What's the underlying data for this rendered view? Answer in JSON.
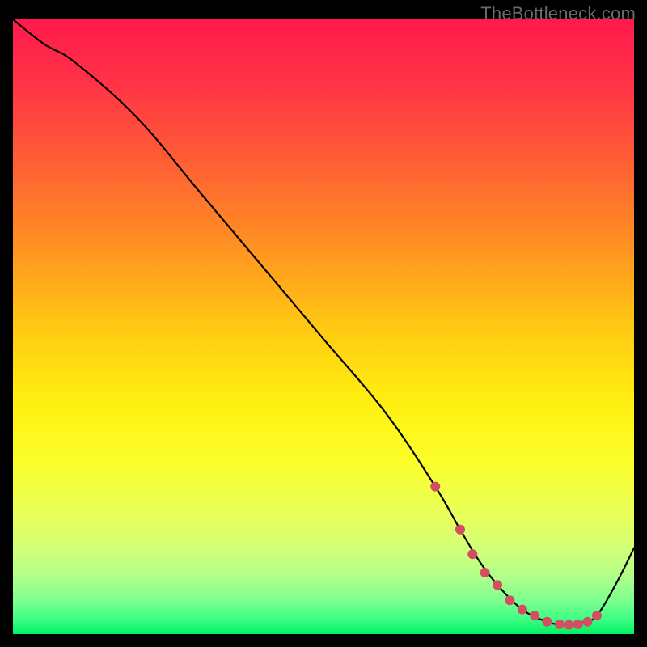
{
  "watermark": "TheBottleneck.com",
  "gradient": {
    "stops": [
      {
        "offset": 0.0,
        "color": "#ff1a4b"
      },
      {
        "offset": 0.1,
        "color": "#ff3246"
      },
      {
        "offset": 0.22,
        "color": "#ff5a36"
      },
      {
        "offset": 0.35,
        "color": "#ff8a24"
      },
      {
        "offset": 0.5,
        "color": "#ffc912"
      },
      {
        "offset": 0.62,
        "color": "#ffef10"
      },
      {
        "offset": 0.72,
        "color": "#fbff2a"
      },
      {
        "offset": 0.8,
        "color": "#eaff58"
      },
      {
        "offset": 0.86,
        "color": "#d3ff76"
      },
      {
        "offset": 0.905,
        "color": "#b2ff8a"
      },
      {
        "offset": 0.945,
        "color": "#7dff8e"
      },
      {
        "offset": 0.975,
        "color": "#3fff85"
      },
      {
        "offset": 1.0,
        "color": "#00f066"
      }
    ]
  },
  "chart_data": {
    "type": "line",
    "title": "",
    "xlabel": "",
    "ylabel": "",
    "xlim": [
      0,
      100
    ],
    "ylim": [
      0,
      100
    ],
    "series": [
      {
        "name": "main-curve",
        "x": [
          0,
          5,
          10,
          20,
          30,
          40,
          50,
          60,
          68,
          72,
          75,
          78,
          82,
          86,
          89,
          92,
          94,
          97,
          100
        ],
        "values": [
          100,
          96,
          93,
          84,
          72,
          60,
          48,
          36,
          24,
          17,
          12,
          8,
          4,
          2,
          1.5,
          2,
          3,
          8,
          14
        ]
      }
    ],
    "markers": {
      "name": "highlight-dots",
      "color": "#d44e62",
      "radius": 6,
      "x": [
        68,
        72,
        74,
        76,
        78,
        80,
        82,
        84,
        86,
        88,
        89.5,
        91,
        92.5,
        94
      ],
      "values": [
        24,
        17,
        13,
        10,
        8,
        5.5,
        4,
        3,
        2,
        1.6,
        1.5,
        1.6,
        2,
        3
      ]
    }
  }
}
